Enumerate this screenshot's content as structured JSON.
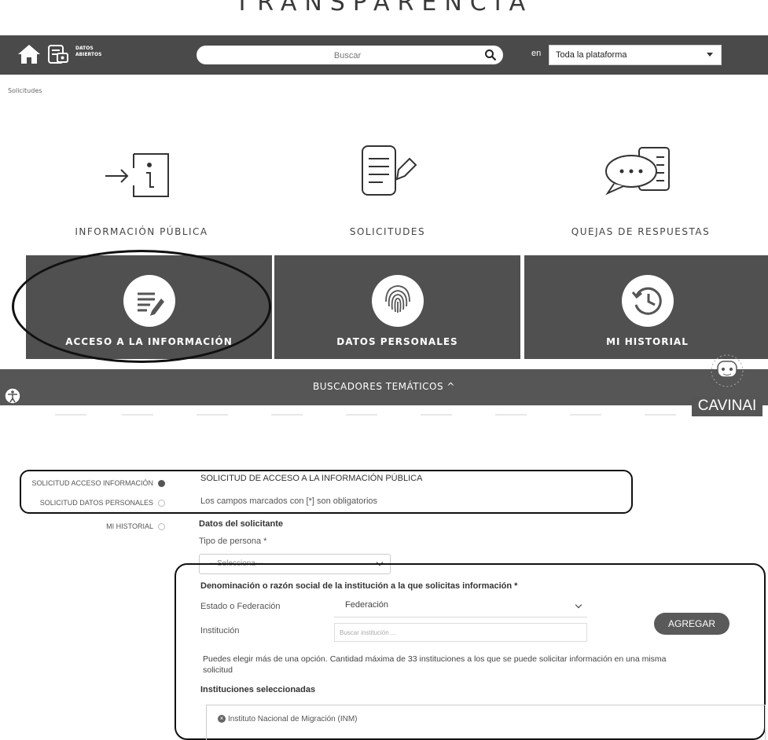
{
  "header": {
    "site_title": "TRANSPARENCIA",
    "datos_abiertos_line1": "DATOS",
    "datos_abiertos_line2": "ABIERTOS",
    "search_placeholder": "Buscar",
    "en_label": "en",
    "scope_selected": "Toda la plataforma"
  },
  "breadcrumb": "Solicitudes",
  "categories": [
    {
      "label": "INFORMACIÓN PÚBLICA",
      "icon": "info-entry-icon"
    },
    {
      "label": "SOLICITUDES",
      "icon": "document-pencil-icon"
    },
    {
      "label": "QUEJAS DE RESPUESTAS",
      "icon": "chat-document-icon"
    }
  ],
  "cards": [
    {
      "label": "ACCESO A LA INFORMACIÓN",
      "icon": "edit-list-icon"
    },
    {
      "label": "DATOS PERSONALES",
      "icon": "fingerprint-icon"
    },
    {
      "label": "MI HISTORIAL",
      "icon": "history-icon"
    }
  ],
  "tematicos": "BUSCADORES TEMÁTICOS ^",
  "cavinai": "CAVINAI",
  "sidebar": {
    "items": [
      {
        "label": "SOLICITUD ACCESO INFORMACIÓN",
        "active": true
      },
      {
        "label": "SOLICITUD DATOS PERSONALES",
        "active": false
      },
      {
        "label": "MI HISTORIAL",
        "active": false
      }
    ]
  },
  "form": {
    "title": "SOLICITUD DE ACCESO A LA INFORMACIÓN PÚBLICA",
    "required_note": "Los campos marcados con [*] son obligatorios",
    "section_solicitante": "Datos del solicitante",
    "tipo_persona_label": "Tipo de persona *",
    "tipo_persona_value": "---Selecciona---",
    "denominacion_label": "Denominación o razón social de la institución a la que solicitas información *",
    "estado_label": "Estado o Federación",
    "estado_value": "Federación",
    "institucion_label": "Institución",
    "institucion_placeholder": "Buscar institución ...",
    "agregar_label": "AGREGAR",
    "help_text_line1": "Puedes elegir más de una opción. Cantidad máxima de 33 instituciones a los que se puede solicitar información en una misma",
    "help_text_line2": "solicitud",
    "seleccionadas_label": "Instituciones seleccionadas",
    "selected_institution": "Instituto Nacional de Migración (INM)"
  },
  "colors": {
    "topbar": "#4a4a4a",
    "card": "#505050",
    "tematicos_bar": "#565656",
    "agregar_button": "#5a5a5a"
  }
}
